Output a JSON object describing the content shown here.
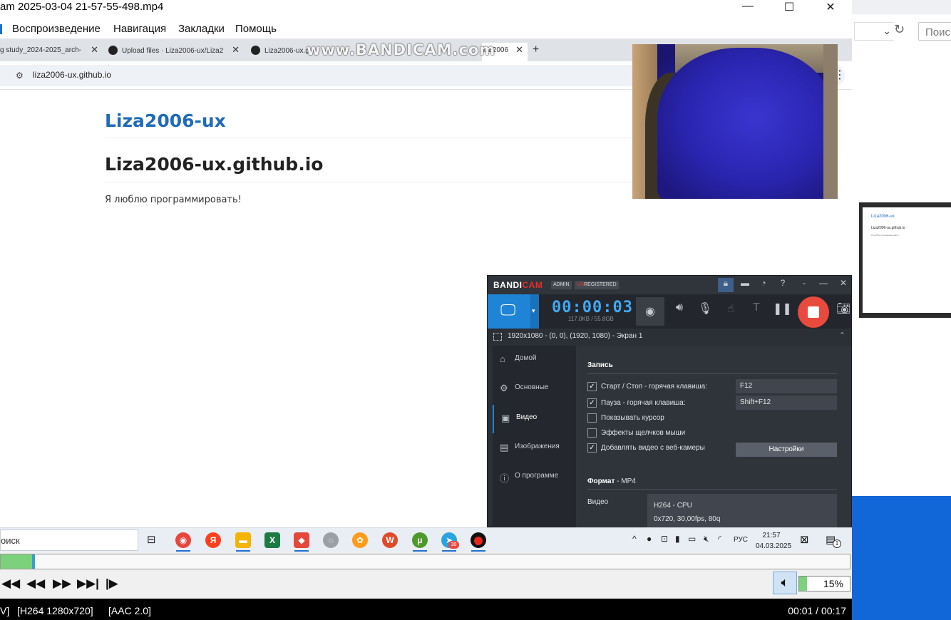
{
  "player": {
    "title": "am 2025-03-04 21-57-55-498.mp4",
    "menu": [
      "Воспроизведение",
      "Навигация",
      "Закладки",
      "Помощь"
    ],
    "progress_fraction": 0.04,
    "volume_label": "15%",
    "volume_fraction": 0.15,
    "status_left": [
      "V]",
      "[H264 1280x720]",
      "[AAC 2.0]"
    ],
    "status_time": "00:01 / 00:17",
    "controls": [
      "skip-back-icon",
      "rewind-icon",
      "fast-forward-icon",
      "skip-forward-icon",
      "frame-step-icon"
    ]
  },
  "browser": {
    "tabs": [
      {
        "label": "g study_2024-2025_arch-"
      },
      {
        "label": "Upload files · Liza2006-ux/Liza2"
      },
      {
        "label": "Liza2006-ux.gi"
      },
      {
        "label": "iza2006"
      }
    ],
    "new_tab": "+",
    "url": "liza2006-ux.github.io",
    "page": {
      "site_title": "Liza2006-ux",
      "heading": "Liza2006-ux.github.io",
      "paragraph": "Я люблю программировать!"
    }
  },
  "watermark": "www.BANDICAM.com",
  "bandicam": {
    "logo_a": "BANDI",
    "logo_b": "CAM",
    "tag_admin": "ADMIN",
    "tag_unreg_a": "UN",
    "tag_unreg_b": "REGISTERED",
    "timer": "00:00:03",
    "size": "117.0KB / 55.8GB",
    "region": "1920x1080 - (0, 0), (1920, 1080) - Экран 1",
    "nav": [
      "Домой",
      "Основные",
      "Видео",
      "Изображения",
      "О программе"
    ],
    "active_nav": "Видео",
    "record_section": "Запись",
    "rows": [
      {
        "label": "Старт / Стоп - горячая клавиша:",
        "checked": true,
        "value": "F12"
      },
      {
        "label": "Пауза - горячая клавиша:",
        "checked": true,
        "value": "Shift+F12"
      },
      {
        "label": "Показывать курсор",
        "checked": false
      },
      {
        "label": "Эффекты щелчков мыши",
        "checked": false
      },
      {
        "label": "Добавлять видео с веб-камеры",
        "checked": true
      }
    ],
    "settings_button": "Настройки",
    "format_label": "Формат",
    "format_value": " - MP4",
    "video_label": "Видео",
    "video_codec": "H264 - CPU",
    "video_params": "0x720, 30,00fps, 80q"
  },
  "taskbar": {
    "search": "оиск",
    "language": "РУС",
    "time": "21:57",
    "date": "04.03.2025",
    "notification_count": "1",
    "telegram_badge": "30"
  },
  "background": {
    "search": "Поис",
    "thumb_title": "Liza2006-ux",
    "thumb_heading": "Liza2006-ux.github.io",
    "thumb_text": "Я люблю программировать!"
  },
  "colors": {
    "bandicam_blue": "#1f84d6",
    "bandicam_red": "#e2302b",
    "link_blue": "#1f6bb8",
    "progress_green": "#7cd17c"
  }
}
